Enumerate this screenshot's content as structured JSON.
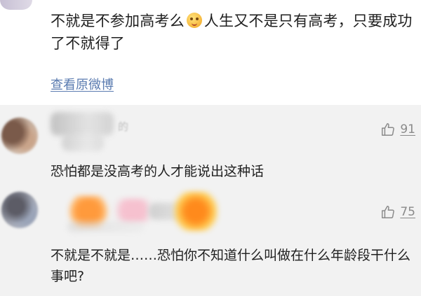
{
  "post": {
    "text_part1": "不就是不参加高考么",
    "text_part2": "人生又不是只有高考，只要成功了不就得了",
    "emoji_icon": "yum-face-emoji",
    "view_original_link": "查看原微博"
  },
  "comments": [
    {
      "username_visible_suffix": "的",
      "likes": "91",
      "text": "恐怕都是没高考的人才能说出这种话"
    },
    {
      "likes": "75",
      "text": "不就是不就是……恐怕你不知道什么叫做在什么年龄段干什么事吧?"
    }
  ],
  "colors": {
    "link": "#5a7bb0",
    "meta": "#8a8a8a",
    "background": "#f2f2f2",
    "card": "#ffffff"
  }
}
